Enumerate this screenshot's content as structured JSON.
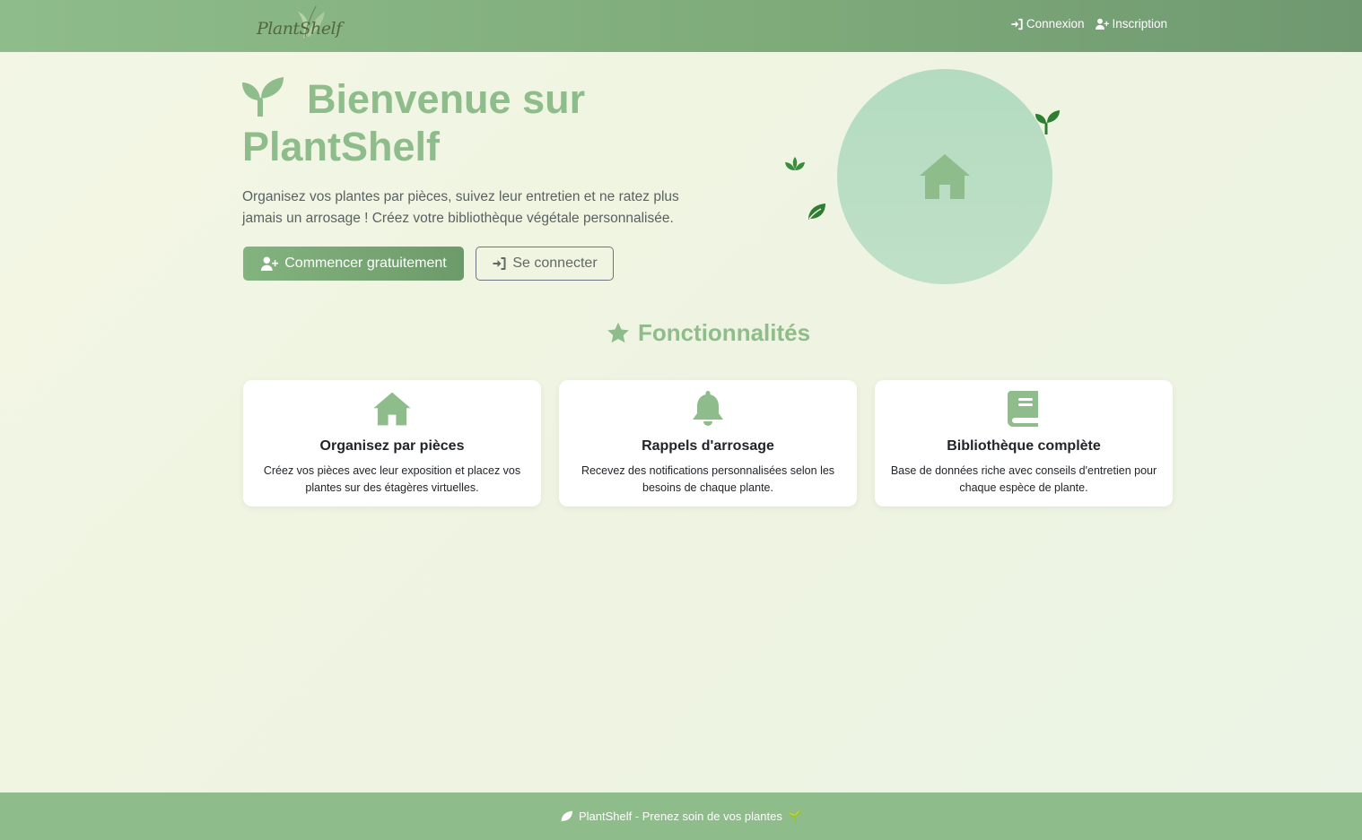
{
  "navbar": {
    "brand": "PlantShelf",
    "links": [
      {
        "label": "Connexion",
        "icon": "sign-in-icon"
      },
      {
        "label": "Inscription",
        "icon": "user-plus-icon"
      }
    ]
  },
  "hero": {
    "title": "Bienvenue sur PlantShelf",
    "subtitle": "Organisez vos plantes par pièces, suivez leur entretien et ne ratez plus jamais un arrosage ! Créez votre bibliothèque végétale personnalisée.",
    "primary_button": "Commencer gratuitement",
    "secondary_button": "Se connecter"
  },
  "features": {
    "title": "Fonctionnalités",
    "cards": [
      {
        "icon": "house-icon",
        "title": "Organisez par pièces",
        "text": "Créez vos pièces avec leur exposition et placez vos plantes sur des étagères virtuelles."
      },
      {
        "icon": "bell-icon",
        "title": "Rappels d'arrosage",
        "text": "Recevez des notifications personnalisées selon les besoins de chaque plante."
      },
      {
        "icon": "book-icon",
        "title": "Bibliothèque complète",
        "text": "Base de données riche avec conseils d'entretien pour chaque espèce de plante."
      }
    ]
  },
  "footer": {
    "text": "PlantShelf - Prenez soin de vos plantes",
    "emoji": "🌱"
  },
  "colors": {
    "accent": "#8fbc8b",
    "accent_dark": "#6d9a6a",
    "circle": "#b3dbc0",
    "leaf_dark": "#2e7d32"
  }
}
